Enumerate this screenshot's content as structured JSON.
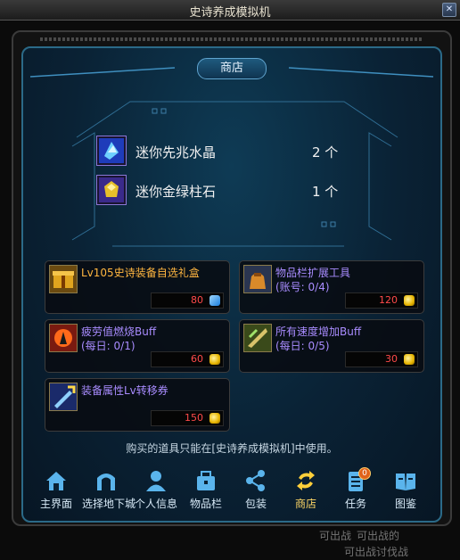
{
  "window": {
    "title": "史诗养成模拟机",
    "close_glyph": "✕"
  },
  "shop": {
    "tab_label": "商店",
    "rewards": [
      {
        "name": "迷你先兆水晶",
        "count": "2 个",
        "icon": "blue-crystal-icon"
      },
      {
        "name": "迷你金绿柱石",
        "count": "1 个",
        "icon": "gold-gem-icon"
      }
    ],
    "items": [
      {
        "name": "Lv105史诗装备自选礼盒",
        "sub": "",
        "price": "80",
        "currency": "blue-crystal",
        "name_color": "#ffb640"
      },
      {
        "name": "物品栏扩展工具",
        "sub": "(账号: 0/4)",
        "price": "120",
        "currency": "gold",
        "name_color": "#a98cff"
      },
      {
        "name": "疲劳值燃烧Buff",
        "sub": "(每日: 0/1)",
        "price": "60",
        "currency": "gold",
        "name_color": "#a98cff"
      },
      {
        "name": "所有速度增加Buff",
        "sub": "(每日: 0/5)",
        "price": "30",
        "currency": "gold",
        "name_color": "#a98cff"
      },
      {
        "name": "装备属性Lv转移券",
        "sub": "",
        "price": "150",
        "currency": "gold",
        "name_color": "#a98cff"
      }
    ],
    "note": "购买的道具只能在[史诗养成模拟机]中使用。"
  },
  "nav": [
    {
      "label": "主界面",
      "icon": "home-icon"
    },
    {
      "label": "选择地下城",
      "icon": "gate-icon"
    },
    {
      "label": "个人信息",
      "icon": "person-icon"
    },
    {
      "label": "物品栏",
      "icon": "inventory-icon"
    },
    {
      "label": "包装",
      "icon": "share-icon"
    },
    {
      "label": "商店",
      "icon": "shop-refresh-icon",
      "active": true
    },
    {
      "label": "任务",
      "icon": "quest-icon",
      "badge": "0"
    },
    {
      "label": "图鉴",
      "icon": "book-icon"
    }
  ],
  "background_text": [
    "可出战",
    "可出战的",
    "可出战讨伐战"
  ],
  "colors": {
    "accent_frame": "#2b6a88",
    "price_red": "#ff4a4a",
    "active_nav": "#ffd866"
  }
}
